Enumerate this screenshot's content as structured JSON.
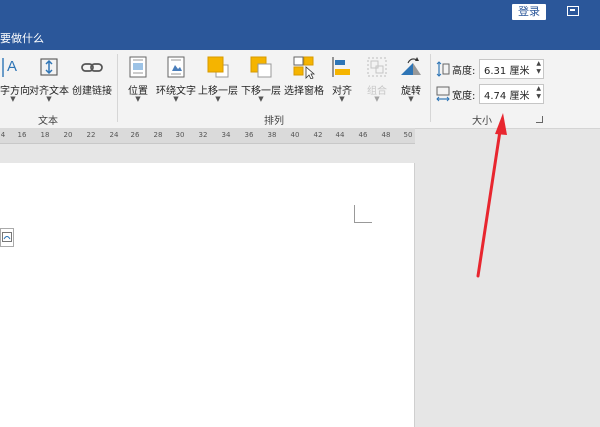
{
  "titlebar": {
    "login_label": "登录",
    "ribbon_display_icon": "ribbon-display-options-icon"
  },
  "tell_me": {
    "text": "要做什么"
  },
  "ribbon": {
    "text_group": {
      "label": "文本",
      "buttons": [
        {
          "label": "字方向",
          "icon": "text-direction-icon",
          "has_dropdown": true
        },
        {
          "label": "对齐文本",
          "icon": "align-text-icon",
          "has_dropdown": true
        },
        {
          "label": "创建链接",
          "icon": "create-link-icon",
          "has_dropdown": false
        }
      ]
    },
    "arrange_group": {
      "label": "排列",
      "buttons": [
        {
          "label": "位置",
          "icon": "position-icon",
          "has_dropdown": true
        },
        {
          "label": "环绕文字",
          "icon": "wrap-text-icon",
          "has_dropdown": true
        },
        {
          "label": "上移一层",
          "icon": "bring-forward-icon",
          "has_dropdown": true
        },
        {
          "label": "下移一层",
          "icon": "send-backward-icon",
          "has_dropdown": true
        },
        {
          "label": "选择窗格",
          "icon": "selection-pane-icon",
          "has_dropdown": false
        },
        {
          "label": "对齐",
          "icon": "align-icon",
          "has_dropdown": true
        },
        {
          "label": "组合",
          "icon": "group-icon",
          "has_dropdown": true,
          "disabled": true
        },
        {
          "label": "旋转",
          "icon": "rotate-icon",
          "has_dropdown": true
        }
      ]
    },
    "size_group": {
      "label": "大小",
      "height": {
        "label": "高度:",
        "value": "6.31 厘米",
        "icon": "height-icon"
      },
      "width": {
        "label": "宽度:",
        "value": "4.74 厘米",
        "icon": "width-icon"
      }
    }
  },
  "ruler": {
    "ticks": [
      "4",
      "16",
      "18",
      "20",
      "22",
      "24",
      "26",
      "28",
      "30",
      "32",
      "34",
      "36",
      "38",
      "40",
      "42",
      "44",
      "46",
      "48",
      "50"
    ]
  },
  "colors": {
    "brand": "#2b579a",
    "annotation_arrow": "#e8262f",
    "icon_orange": "#f5b400"
  }
}
